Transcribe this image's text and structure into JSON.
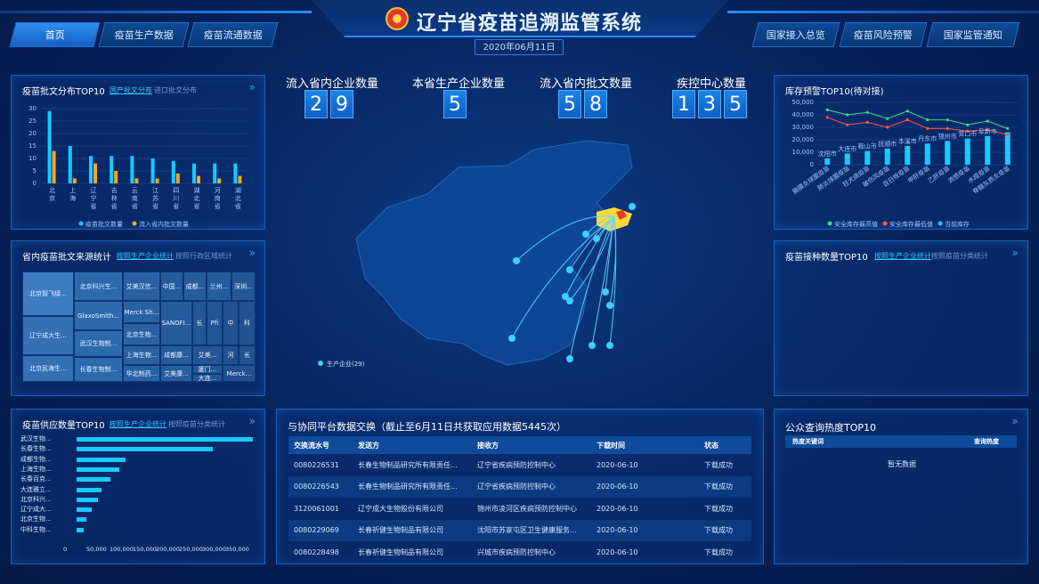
{
  "header": {
    "title": "辽宁省疫苗追溯监管系统",
    "date": "2020年06月11日",
    "left_tabs": [
      "首页",
      "疫苗生产数据",
      "疫苗流通数据"
    ],
    "right_tabs": [
      "国家接入总览",
      "疫苗风险预警",
      "国家监管通知"
    ]
  },
  "stats": [
    {
      "label": "流入省内企业数量",
      "digits": [
        "2",
        "9"
      ]
    },
    {
      "label": "本省生产企业数量",
      "digits": [
        "5"
      ]
    },
    {
      "label": "流入省内批文数量",
      "digits": [
        "5",
        "8"
      ]
    },
    {
      "label": "疾控中心数量",
      "digits": [
        "1",
        "3",
        "5"
      ]
    }
  ],
  "batch_panel": {
    "title": "疫苗批文分布TOP10",
    "tab_on": "国产批文分布",
    "tab_off": "进口批文分布",
    "legend": [
      "疫苗批文数量",
      "流入省内批文数量"
    ],
    "colors": [
      "#19c9ff",
      "#f5a623"
    ]
  },
  "batch_chart": {
    "type": "bar",
    "categories": [
      "北京",
      "上海",
      "辽宁省",
      "吉林省",
      "云南省",
      "江苏省",
      "四川省",
      "湖北省",
      "河南省",
      "湖北省"
    ],
    "series": [
      {
        "name": "疫苗批文数量",
        "values": [
          29,
          15,
          11,
          11,
          11,
          10,
          9,
          8,
          8,
          8
        ]
      },
      {
        "name": "流入省内批文数量",
        "values": [
          13,
          2,
          8,
          5,
          2,
          2,
          4,
          3,
          2,
          3
        ]
      }
    ],
    "ylim": [
      0,
      30
    ],
    "yticks": [
      "0",
      "5",
      "10",
      "15",
      "20",
      "25",
      "30"
    ]
  },
  "source_panel": {
    "title": "省内疫苗批文来源统计",
    "tab_on": "按照生产企业统计",
    "tab_off": "按照行政区域统计",
    "cells": [
      "北京智飞绿...",
      "北京科兴生...",
      "艾美汉信...",
      "中国...",
      "成都...",
      "兰州...",
      "深圳...",
      "GlaxoSmith...",
      "Merck Sh...",
      "辽宁成大生...",
      "北京生物...",
      "SANOFI...",
      "长",
      "Pfi",
      "中",
      "科",
      "武汉生物制...",
      "上海生物...",
      "成都康...",
      "艾美...",
      "河",
      "长",
      "北京民海生...",
      "长春生物制...",
      "华北制药...",
      "艾美康...",
      "厦门...",
      "大连...",
      "Merck..."
    ]
  },
  "supply_panel": {
    "title": "疫苗供应数量TOP10",
    "tab_on": "按照生产企业统计",
    "tab_off": "按照疫苗分类统计",
    "rows": [
      "武汉生物...",
      "长春生物...",
      "成都生物...",
      "上海生物...",
      "长春百克...",
      "大连雅立...",
      "北京科兴...",
      "辽宁成大...",
      "北京生物...",
      "中科生物..."
    ],
    "values": [
      350000,
      270000,
      98000,
      85000,
      68000,
      50000,
      42000,
      30000,
      20000,
      15000
    ],
    "xticks": [
      "0",
      "50,000",
      "100,000",
      "150,000",
      "200,000",
      "250,000",
      "300,000",
      "350,000"
    ]
  },
  "stock_panel": {
    "title": "库存预警TOP10(待对接)",
    "legend": [
      "安全库存最高值",
      "安全库存最低值",
      "当前库存"
    ],
    "colors": [
      "#3ddc84",
      "#ff5a3c",
      "#19c9ff"
    ]
  },
  "stock_chart": {
    "type": "line",
    "cities": [
      "沈阳市",
      "大连市",
      "鞍山市",
      "抚顺市",
      "本溪市",
      "丹东市",
      "锦州市",
      "营口市",
      "阜新市"
    ],
    "vaccines": [
      "脑膜炎球菌疫苗",
      "肺炎球菌疫苗",
      "狂犬病疫苗",
      "破伤风疫苗",
      "百日咳疫苗",
      "甲肝疫苗",
      "乙肝疫苗",
      "流感疫苗",
      "水痘疫苗",
      "脊髓灰质炎疫苗"
    ],
    "max": [
      44000,
      40000,
      42000,
      37000,
      43000,
      36000,
      36000,
      32000,
      35000,
      29000
    ],
    "min": [
      38000,
      32000,
      34000,
      30000,
      36000,
      29000,
      29000,
      27000,
      28000,
      24000
    ],
    "current": [
      5000,
      9000,
      11000,
      13000,
      15000,
      17000,
      19000,
      21000,
      23000,
      26000
    ],
    "yticks": [
      "0",
      "10,000",
      "20,000",
      "30,000",
      "40,000",
      "50,000"
    ],
    "ylim": [
      0,
      50000
    ]
  },
  "vaccinate_panel": {
    "title": "疫苗接种数量TOP10",
    "tab_on": "按照生产企业统计",
    "tab_off": "按照疫苗分类统计"
  },
  "hot_panel": {
    "title": "公众查询热度TOP10",
    "col1": "热度关键词",
    "col2": "查询热度",
    "empty": "暂无数据"
  },
  "map": {
    "legend": "生产企业(29)"
  },
  "exchange": {
    "title": "与协同平台数据交换（截止至6月11日共获取应用数据5445次）",
    "headers": [
      "交换流水号",
      "发送方",
      "接收方",
      "下载时间",
      "状态"
    ],
    "rows": [
      [
        "0080226531",
        "长春生物制品研究所有限责任...",
        "辽宁省疾病预防控制中心",
        "2020-06-10",
        "下载成功"
      ],
      [
        "0080226543",
        "长春生物制品研究所有限责任...",
        "辽宁省疾病预防控制中心",
        "2020-06-10",
        "下载成功"
      ],
      [
        "3120061001",
        "辽宁成大生物股份有限公司",
        "锦州市凌河区疾病预防控制中心",
        "2020-06-10",
        "下载成功"
      ],
      [
        "0080229069",
        "长春祈健生物制品有限公司",
        "沈阳市苏家屯区卫生健康服务...",
        "2020-06-10",
        "下载成功"
      ],
      [
        "0080228498",
        "长春祈健生物制品有限公司",
        "兴城市疾病预防控制中心",
        "2020-06-10",
        "下载成功"
      ]
    ]
  }
}
